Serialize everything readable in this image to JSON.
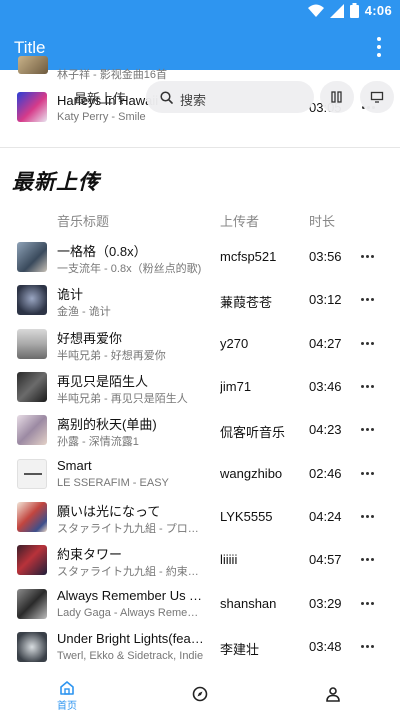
{
  "status_bar": {
    "time": "4:06"
  },
  "app_bar": {
    "title": "Title"
  },
  "partial_rows": [
    {
      "subtitle": "林子祥 - 影视金曲16首"
    },
    {
      "title": "Harleys In Hawaii",
      "subtitle": "Katy Perry - Smile",
      "duration": "03:05"
    }
  ],
  "floating_bar": {
    "section_label": "最新上传",
    "search_placeholder": "搜索"
  },
  "section": {
    "title": "最新上传"
  },
  "columns": {
    "title": "音乐标题",
    "uploader": "上传者",
    "duration": "时长"
  },
  "songs": [
    {
      "title": "一格格（0.8x）",
      "subtitle": "一支流年 - 0.8x（粉丝点的歌)",
      "uploader": "mcfsp521",
      "duration": "03:56"
    },
    {
      "title": "诡计",
      "subtitle": "金渔 - 诡计",
      "uploader": "蒹葭苍苍",
      "duration": "03:12"
    },
    {
      "title": "好想再爱你",
      "subtitle": "半吨兄弟 - 好想再爱你",
      "uploader": "y270",
      "duration": "04:27"
    },
    {
      "title": "再见只是陌生人",
      "subtitle": "半吨兄弟 - 再见只是陌生人",
      "uploader": "jim71",
      "duration": "03:46"
    },
    {
      "title": "离别的秋天(单曲)",
      "subtitle": "孙露 - 深情流露1",
      "uploader": "侃客听音乐",
      "duration": "04:23"
    },
    {
      "title": "Smart",
      "subtitle": "LE SSERAFIM - EASY",
      "uploader": "wangzhibo",
      "duration": "02:46"
    },
    {
      "title": "願いは光になって",
      "subtitle": "スタァライト九九組 - プロローグ",
      "uploader": "LYK5555",
      "duration": "04:24"
    },
    {
      "title": "約束タワー",
      "subtitle": "スタァライト九九組 - 約束タワー",
      "uploader": "liiiii",
      "duration": "04:57"
    },
    {
      "title": "Always Remember Us This Way",
      "subtitle": "Lady Gaga - Always Remember Us",
      "uploader": "shanshan",
      "duration": "03:29"
    },
    {
      "title": "Under Bright Lights(feat. Ekko)",
      "subtitle": "Twerl, Ekko & Sidetrack, Indie",
      "uploader": "李建壮",
      "duration": "03:48"
    }
  ],
  "bottom_nav": [
    {
      "label": "首页",
      "icon": "home-icon",
      "active": true
    },
    {
      "label": "",
      "icon": "compass-icon",
      "active": false
    },
    {
      "label": "",
      "icon": "person-icon",
      "active": false
    }
  ],
  "colors": {
    "primary": "#2e95f0",
    "text": "#111111",
    "muted": "#777777"
  }
}
